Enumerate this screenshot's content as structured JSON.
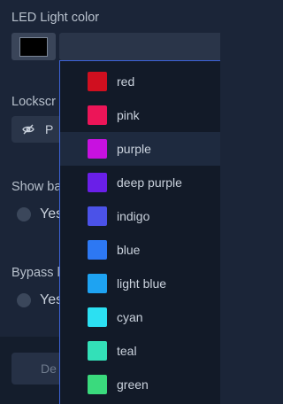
{
  "form": {
    "led_label": "LED Light color",
    "lockscreen_label": "Lockscr",
    "lockscreen_button_text": "P",
    "show_label": "Show ba",
    "show_option": "Yes",
    "bypass_label": "Bypass l",
    "bypass_option": "Yes",
    "footer_button": "De",
    "current_color": "#000000"
  },
  "dropdown": {
    "highlighted": "purple",
    "options": [
      {
        "label": "red",
        "color": "#d00f1f"
      },
      {
        "label": "pink",
        "color": "#ec1558"
      },
      {
        "label": "purple",
        "color": "#c811e0"
      },
      {
        "label": "deep purple",
        "color": "#6a1fe8"
      },
      {
        "label": "indigo",
        "color": "#4b52e8"
      },
      {
        "label": "blue",
        "color": "#2d78f3"
      },
      {
        "label": "light blue",
        "color": "#1ea3f2"
      },
      {
        "label": "cyan",
        "color": "#2ce0f2"
      },
      {
        "label": "teal",
        "color": "#33e0b8"
      },
      {
        "label": "green",
        "color": "#3ada7d"
      }
    ]
  }
}
